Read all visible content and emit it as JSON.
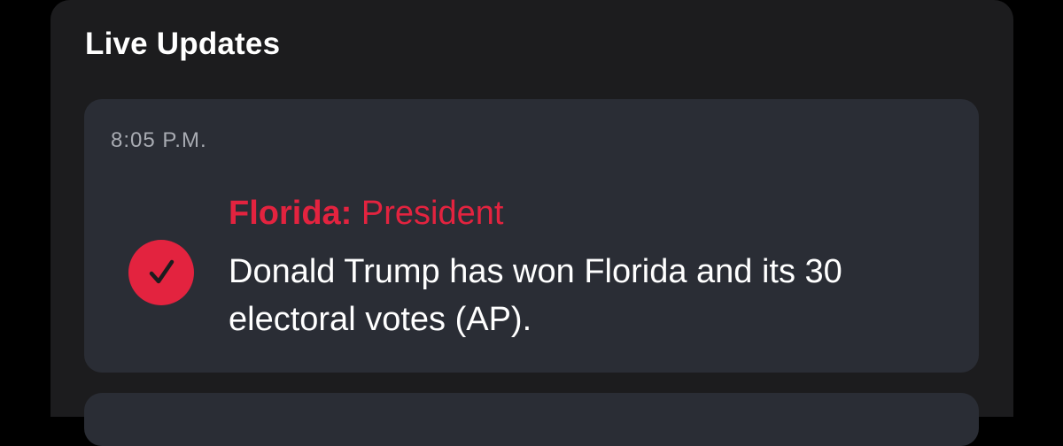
{
  "panel": {
    "title": "Live Updates"
  },
  "updates": [
    {
      "time": "8:05 P.M.",
      "state": "Florida:",
      "office": "President",
      "icon": "check-circle-icon",
      "text": "Donald Trump has won Florida and its 30 electoral votes (AP)."
    }
  ],
  "colors": {
    "accent": "#e3233f",
    "panel_bg": "#1c1c1e",
    "card_bg": "#2a2d35"
  }
}
